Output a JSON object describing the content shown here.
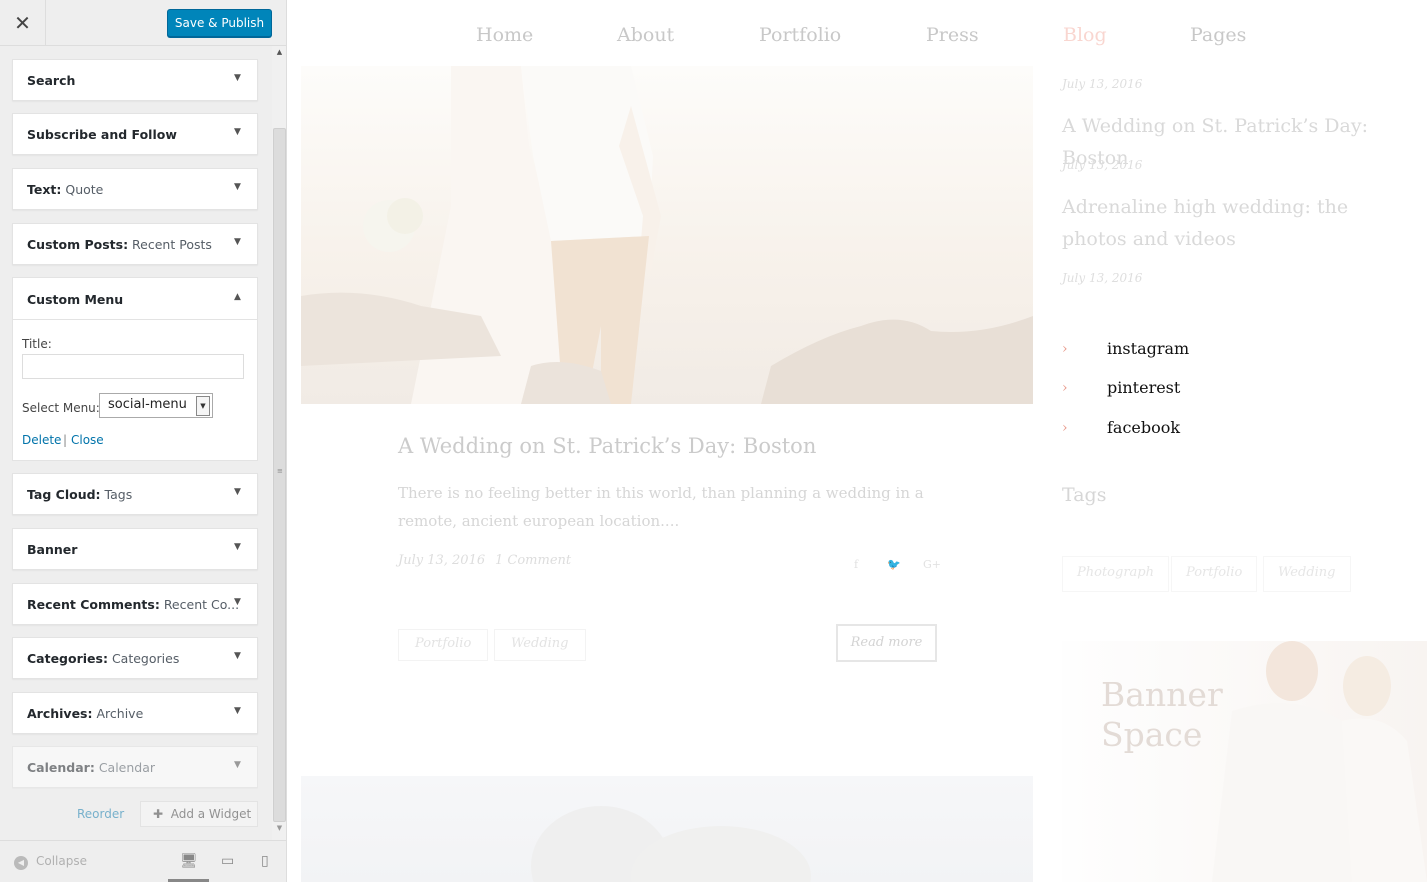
{
  "topbar": {
    "close_glyph": "✕",
    "publish_label": "Save & Publish"
  },
  "widgets": [
    {
      "name": "Search",
      "sub": ""
    },
    {
      "name": "Subscribe and Follow",
      "sub": ""
    },
    {
      "name": "Text",
      "sub": "Quote"
    },
    {
      "name": "Custom Posts",
      "sub": "Recent Posts"
    },
    {
      "name": "Custom Menu",
      "sub": ""
    },
    {
      "name": "Tag Cloud",
      "sub": "Tags"
    },
    {
      "name": "Banner",
      "sub": ""
    },
    {
      "name": "Recent Comments",
      "sub": "Recent Co..."
    },
    {
      "name": "Categories",
      "sub": "Categories"
    },
    {
      "name": "Archives",
      "sub": "Archive"
    },
    {
      "name": "Calendar",
      "sub": "Calendar"
    }
  ],
  "custom_menu": {
    "title_label": "Title:",
    "title_value": "",
    "select_label": "Select Menu:",
    "select_value": "social-menu",
    "delete_label": "Delete",
    "separator": "|",
    "close_label": "Close"
  },
  "footer": {
    "reorder_label": "Reorder",
    "add_widget_label": "Add a Widget",
    "collapse_label": "Collapse"
  },
  "preview": {
    "nav": [
      "Home",
      "About",
      "Portfolio",
      "Press",
      "Blog",
      "Pages"
    ],
    "active_nav": "Blog",
    "post": {
      "title": "A Wedding on St. Patrick’s Day: Boston",
      "excerpt": "There is no feeling better in this world, than planning a wedding in a remote, ancient european location....",
      "date": "July 13, 2016",
      "comments": "1 Comment",
      "tags": [
        "Portfolio",
        "Wedding"
      ],
      "read_more": "Read more"
    },
    "recent": {
      "dates": [
        "July 13, 2016",
        "July 13, 2016",
        "July 13, 2016"
      ],
      "titles": [
        "A Wedding on St. Patrick’s Day: Boston",
        "Adrenaline high wedding: the photos and videos"
      ]
    },
    "social": [
      "instagram",
      "pinterest",
      "facebook"
    ],
    "tags_heading": "Tags",
    "side_tags": [
      "Photograph",
      "Portfolio",
      "Wedding"
    ],
    "banner_text": "Banner Space"
  },
  "colors": {
    "accent": "#0085ba",
    "link": "#0073aa",
    "active_nav": "#f9d6d0",
    "chevron": "#e89a8c"
  }
}
